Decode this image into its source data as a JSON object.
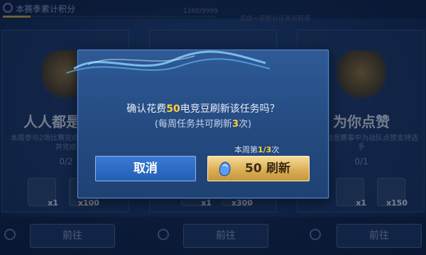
{
  "header": {
    "title": "本赛季累计积分",
    "progress_text": "1260/9999",
    "hint": "完成一定积分任务可获得",
    "progress": 0.13
  },
  "cards": [
    {
      "name": "人人都是电竞",
      "desc": "本周参与2场比赛完成对局获得奖励并完成",
      "count": "0/2",
      "rewards": [
        "x1",
        "x100"
      ],
      "go": "前往"
    },
    {
      "name": "",
      "desc": "",
      "count": "",
      "rewards": [
        "x1",
        "x300"
      ],
      "go": "前往"
    },
    {
      "name": "为你点赞",
      "desc": "在全民电竞赛事中为战队点赞支持选手",
      "count": "0/1",
      "rewards": [
        "x1",
        "x150"
      ],
      "go": "前往"
    }
  ],
  "dialog": {
    "line1_pre": "确认花费",
    "line1_num": "50",
    "line1_post": "电竞豆刷新该任务吗？",
    "line2_pre": "(每周任务共可刷新",
    "line2_num": "3",
    "line2_post": "次)",
    "week_pre": "本周第",
    "week_num": "1/3",
    "week_post": "次",
    "cancel_label": "取消",
    "refresh_cost": "50",
    "refresh_label": "刷新",
    "cost_icon": "bean-icon"
  },
  "colors": {
    "accent_gold": "#ffcf3d",
    "cancel_blue": "#2f6cc6",
    "refresh_gold": "#d9ab52"
  }
}
